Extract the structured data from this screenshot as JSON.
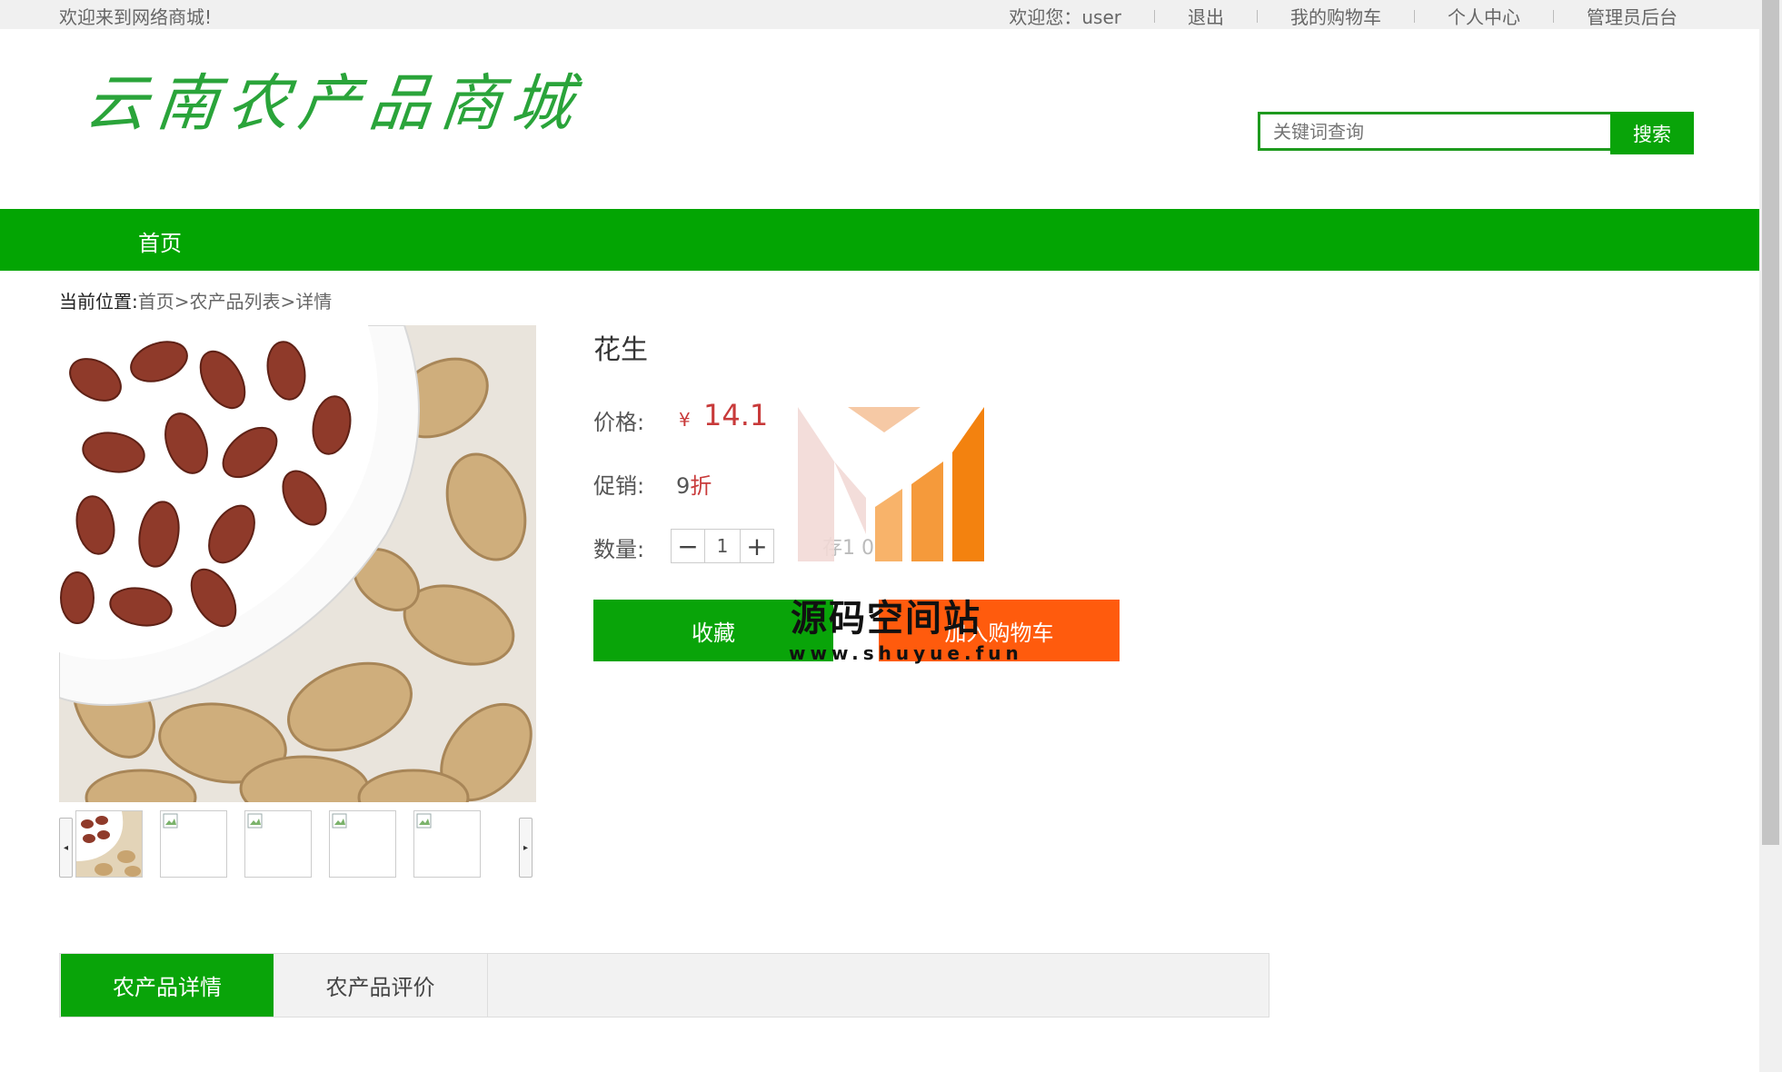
{
  "topbar": {
    "welcome": "欢迎来到网络商城!",
    "links": {
      "greeting": "欢迎您：user",
      "logout": "退出",
      "cart": "我的购物车",
      "profile": "个人中心",
      "admin": "管理员后台"
    }
  },
  "header": {
    "logo_text": "云南农产品商城",
    "search_placeholder": "关键词查询",
    "search_button": "搜索"
  },
  "nav": {
    "home": "首页"
  },
  "breadcrumb": {
    "label": "当前位置:",
    "path": "首页>农产品列表>详情"
  },
  "product": {
    "name": "花生",
    "price_label": "价格:",
    "currency": "¥",
    "price": "14.1",
    "promo_label": "促销:",
    "promo_number": "9",
    "promo_suffix": "折",
    "qty_label": "数量:",
    "qty_minus": "−",
    "qty_plus": "+",
    "qty_value": "1",
    "stock_partial": "存1 04",
    "favorite_button": "收藏",
    "cart_button": "加入购物车"
  },
  "watermark": {
    "title": "源码空间站",
    "url": "www.shuyue.fun"
  },
  "tabs": [
    {
      "label": "农产品详情",
      "active": true
    },
    {
      "label": "农产品评价",
      "active": false
    }
  ],
  "thumbnail_arrows": {
    "prev": "◂",
    "next": "▸"
  },
  "colors": {
    "brand_green": "#03a503",
    "cart_orange": "#ff5b0d",
    "price_red": "#c83a3a"
  }
}
